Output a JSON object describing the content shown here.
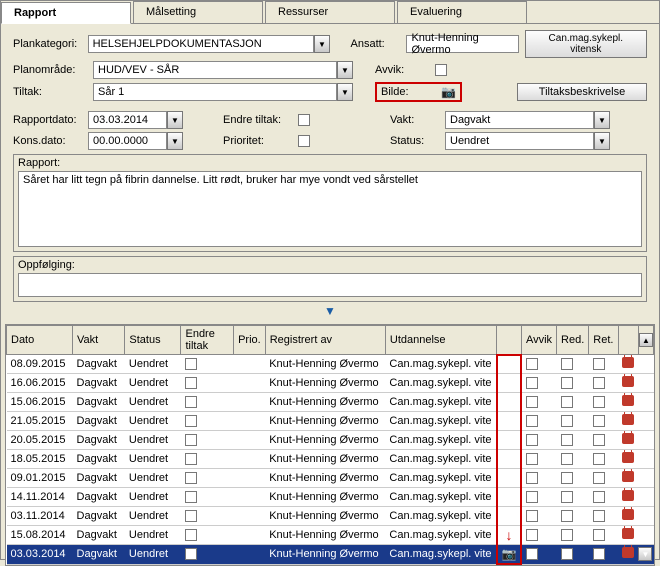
{
  "tabs": {
    "rapport": "Rapport",
    "malsetting": "Målsetting",
    "ressurser": "Ressurser",
    "evaluering": "Evaluering"
  },
  "labels": {
    "plankategori": "Plankategori:",
    "planomrade": "Planområde:",
    "tiltak": "Tiltak:",
    "ansatt": "Ansatt:",
    "avvik": "Avvik:",
    "bilde": "Bilde:",
    "rapportdato": "Rapportdato:",
    "endre_tiltak": "Endre tiltak:",
    "vakt": "Vakt:",
    "kons_dato": "Kons.dato:",
    "prioritet": "Prioritet:",
    "status": "Status:",
    "rapport": "Rapport:",
    "oppfolging": "Oppfølging:"
  },
  "fields": {
    "plankategori": "HELSEHJELPDOKUMENTASJON",
    "planomrade": "HUD/VEV - SÅR",
    "tiltak": "Sår 1",
    "ansatt": "Knut-Henning Øvermo",
    "rapportdato": "03.03.2014",
    "kons_dato": "00.00.0000",
    "vakt": "Dagvakt",
    "status": "Uendret",
    "rapport_text": "Såret har litt tegn på fibrin dannelse. Litt rødt, bruker har mye vondt ved sårstellet"
  },
  "buttons": {
    "can_mag": "Can.mag.sykepl. vitensk",
    "tiltaksbeskrivelse": "Tiltaksbeskrivelse"
  },
  "table": {
    "headers": {
      "dato": "Dato",
      "vakt": "Vakt",
      "status": "Status",
      "endre": "Endre tiltak",
      "prio": "Prio.",
      "reg": "Registrert av",
      "utd": "Utdannelse",
      "img": "",
      "avvik": "Avvik",
      "red": "Red.",
      "ret": "Ret."
    },
    "rows": [
      {
        "dato": "08.09.2015",
        "vakt": "Dagvakt",
        "status": "Uendret",
        "reg": "Knut-Henning Øvermo",
        "utd": "Can.mag.sykepl. vite",
        "img": false,
        "sel": false
      },
      {
        "dato": "16.06.2015",
        "vakt": "Dagvakt",
        "status": "Uendret",
        "reg": "Knut-Henning Øvermo",
        "utd": "Can.mag.sykepl. vite",
        "img": false,
        "sel": false
      },
      {
        "dato": "15.06.2015",
        "vakt": "Dagvakt",
        "status": "Uendret",
        "reg": "Knut-Henning Øvermo",
        "utd": "Can.mag.sykepl. vite",
        "img": false,
        "sel": false
      },
      {
        "dato": "21.05.2015",
        "vakt": "Dagvakt",
        "status": "Uendret",
        "reg": "Knut-Henning Øvermo",
        "utd": "Can.mag.sykepl. vite",
        "img": false,
        "sel": false
      },
      {
        "dato": "20.05.2015",
        "vakt": "Dagvakt",
        "status": "Uendret",
        "reg": "Knut-Henning Øvermo",
        "utd": "Can.mag.sykepl. vite",
        "img": false,
        "sel": false
      },
      {
        "dato": "18.05.2015",
        "vakt": "Dagvakt",
        "status": "Uendret",
        "reg": "Knut-Henning Øvermo",
        "utd": "Can.mag.sykepl. vite",
        "img": false,
        "sel": false
      },
      {
        "dato": "09.01.2015",
        "vakt": "Dagvakt",
        "status": "Uendret",
        "reg": "Knut-Henning Øvermo",
        "utd": "Can.mag.sykepl. vite",
        "img": false,
        "sel": false
      },
      {
        "dato": "14.11.2014",
        "vakt": "Dagvakt",
        "status": "Uendret",
        "reg": "Knut-Henning Øvermo",
        "utd": "Can.mag.sykepl. vite",
        "img": false,
        "sel": false
      },
      {
        "dato": "03.11.2014",
        "vakt": "Dagvakt",
        "status": "Uendret",
        "reg": "Knut-Henning Øvermo",
        "utd": "Can.mag.sykepl. vite",
        "img": false,
        "sel": false
      },
      {
        "dato": "15.08.2014",
        "vakt": "Dagvakt",
        "status": "Uendret",
        "reg": "Knut-Henning Øvermo",
        "utd": "Can.mag.sykepl. vite",
        "img": false,
        "sel": false
      },
      {
        "dato": "03.03.2014",
        "vakt": "Dagvakt",
        "status": "Uendret",
        "reg": "Knut-Henning Øvermo",
        "utd": "Can.mag.sykepl. vite",
        "img": true,
        "sel": true
      }
    ]
  }
}
